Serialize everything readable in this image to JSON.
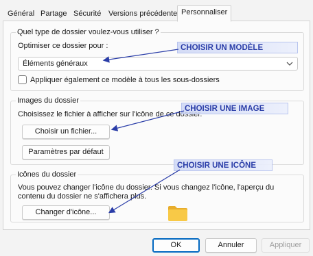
{
  "tabs": [
    "Général",
    "Partage",
    "Sécurité",
    "Versions précédentes",
    "Personnaliser"
  ],
  "active_tab": "Personnaliser",
  "folder_type": {
    "legend": "Quel type de dossier voulez-vous utiliser ?",
    "optimize_label": "Optimiser ce dossier pour :",
    "selected_value": "Éléments généraux",
    "apply_checkbox_label": "Appliquer également ce modèle à tous les sous-dossiers",
    "apply_checked": false
  },
  "folder_images": {
    "legend": "Images du dossier",
    "choose_label": "Choisissez le fichier à afficher sur l'icône de ce dossier.",
    "choose_button": "Choisir un fichier...",
    "default_button": "Paramètres par défaut"
  },
  "folder_icons": {
    "legend": "Icônes du dossier",
    "desc_line1": "Vous pouvez changer l'icône du dossier. Si vous changez l'icône, l'aperçu du",
    "desc_line2": "contenu du dossier ne s'affichera plus.",
    "change_button": "Changer d'icône..."
  },
  "footer": {
    "ok": "OK",
    "cancel": "Annuler",
    "apply": "Appliquer",
    "apply_enabled": false
  },
  "annotations": {
    "model": "CHOISIR UN MODÈLE",
    "image": "CHOISIR UNE IMAGE",
    "icon": "CHOISIR UNE ICÔNE"
  },
  "colors": {
    "accent": "#0067c0",
    "callout_text": "#2a3da8",
    "folder": "#f8c947"
  },
  "icons": {
    "dropdown": "chevron-down-icon",
    "folder": "folder-icon"
  }
}
